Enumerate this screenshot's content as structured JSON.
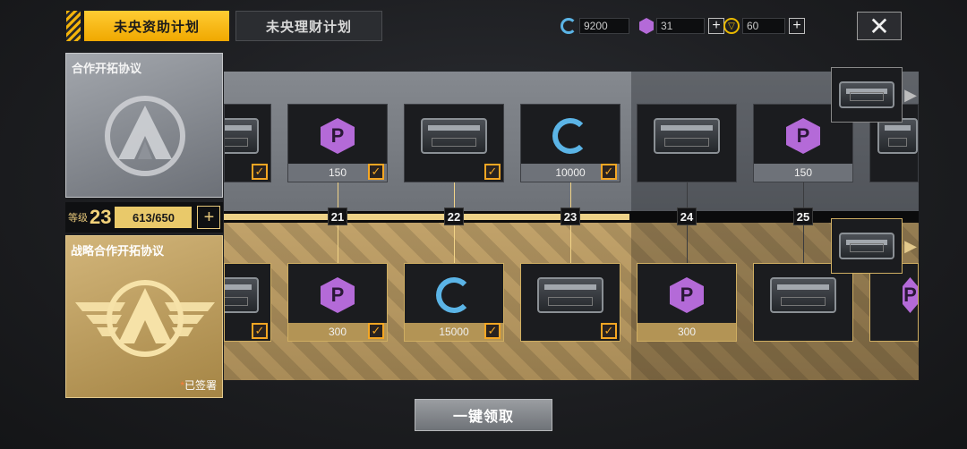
{
  "tabs": {
    "active": "未央资助计划",
    "inactive": "未央理财计划"
  },
  "currencies": [
    {
      "icon": "g-coin-icon",
      "value": "9200"
    },
    {
      "icon": "p-coin-icon",
      "value": "31"
    },
    {
      "icon": "token-icon",
      "value": "60"
    }
  ],
  "left_panel": {
    "basic_title": "合作开拓协议",
    "level_label": "等级",
    "level": "23",
    "exp": "613/650",
    "premium_title": "战略合作开拓协议",
    "signed_mark": "*",
    "signed_text": "已签署"
  },
  "track": {
    "levels": [
      "21",
      "22",
      "23",
      "24",
      "25"
    ],
    "top_rewards": [
      {
        "type": "crate",
        "count": "",
        "claimed": true
      },
      {
        "type": "p-coin",
        "count": "150",
        "claimed": true
      },
      {
        "type": "crate",
        "count": "",
        "claimed": true
      },
      {
        "type": "g-coin",
        "count": "10000",
        "claimed": true
      },
      {
        "type": "crate",
        "count": "",
        "claimed": false
      },
      {
        "type": "p-coin",
        "count": "150",
        "claimed": false
      }
    ],
    "bottom_rewards": [
      {
        "type": "crate",
        "count": "",
        "claimed": true
      },
      {
        "type": "p-coin",
        "count": "300",
        "claimed": true
      },
      {
        "type": "g-coin",
        "count": "15000",
        "claimed": true
      },
      {
        "type": "crate",
        "count": "",
        "claimed": true
      },
      {
        "type": "p-coin",
        "count": "300",
        "claimed": false
      },
      {
        "type": "crate",
        "count": "",
        "claimed": false
      }
    ],
    "check_glyph": "✓"
  },
  "claim_button": "一键领取",
  "colors": {
    "accent": "#f5b40a",
    "gold": "#cfae62",
    "check": "#f5a623",
    "p_coin": "#b46ad8",
    "g_coin": "#5bb4e6"
  }
}
